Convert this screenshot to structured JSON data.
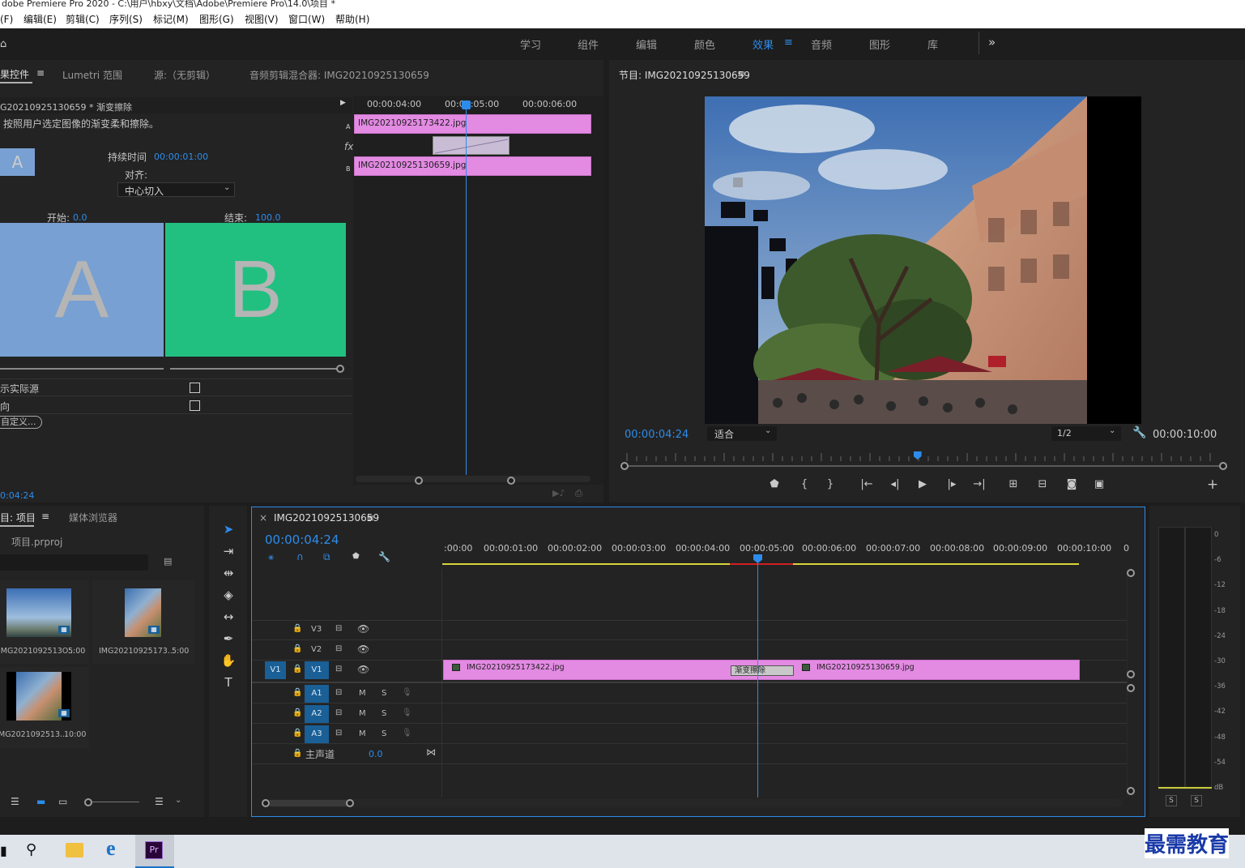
{
  "window_title": "dobe Premiere Pro 2020 - C:\\用户\\hbxy\\文档\\Adobe\\Premiere Pro\\14.0\\项目 *",
  "menu": [
    "(F)",
    "编辑(E)",
    "剪辑(C)",
    "序列(S)",
    "标记(M)",
    "图形(G)",
    "视图(V)",
    "窗口(W)",
    "帮助(H)"
  ],
  "workspaces": {
    "items": [
      "学习",
      "组件",
      "编辑",
      "颜色",
      "效果",
      "音频",
      "图形",
      "库"
    ],
    "active": "效果",
    "more": "»",
    "menu_icon": "≡"
  },
  "effect_panel": {
    "tabs": [
      "果控件",
      "Lumetri 范围",
      "源:（无剪辑）",
      "音频剪辑混合器: IMG20210925130659"
    ],
    "menu_icon": "≡",
    "clip_line": "G20210925130659 * 渐变擦除",
    "description": "按照用户选定图像的渐变柔和擦除。",
    "thumb_letter": "A",
    "duration_label": "持续时间",
    "duration_value": "00:00:01:00",
    "align_label": "对齐:",
    "align_value": "中心切入",
    "start_label": "开始:",
    "start_value": "0.0",
    "end_label": "结束:",
    "end_value": "100.0",
    "preview_a": "A",
    "preview_b": "B",
    "show_actual": "示实际源",
    "reverse": "向",
    "custom": "自定义...",
    "timecode": "0:04:24",
    "mini_timeline": {
      "ticks": [
        "00:00:04:00",
        "00:00:05:00",
        "00:00:06:00"
      ],
      "clip_a": "IMG20210925173422.jpg",
      "clip_b": "IMG20210925130659.jpg",
      "label_a": "A",
      "label_b": "B",
      "fx": "fx"
    }
  },
  "program": {
    "title": "节目: IMG20210925130659",
    "menu_icon": "≡",
    "timecode": "00:00:04:24",
    "fit": "适合",
    "resolution": "1/2",
    "duration": "00:00:10:00",
    "playhead_fraction": 0.49
  },
  "project": {
    "tabs": [
      "目: 项目",
      "媒体浏览器"
    ],
    "menu_icon": "≡",
    "file": "项目.prproj",
    "items": [
      {
        "name": "IMG2021092513O...",
        "duration": "5:00"
      },
      {
        "name": "IMG20210925173...",
        "duration": "5:00"
      },
      {
        "name": "MG2021092513...",
        "duration": "10:00"
      }
    ]
  },
  "timeline": {
    "close": "×",
    "title": "IMG20210925130659",
    "menu_icon": "≡",
    "timecode": "00:00:04:24",
    "ruler": [
      ":00:00",
      "00:00:01:00",
      "00:00:02:00",
      "00:00:03:00",
      "00:00:04:00",
      "00:00:05:00",
      "00:00:06:00",
      "00:00:07:00",
      "00:00:08:00",
      "00:00:09:00",
      "00:00:10:00",
      "0"
    ],
    "video_tracks": [
      "V3",
      "V2",
      "V1"
    ],
    "source_patch": "V1",
    "audio_tracks": [
      "A1",
      "A2",
      "A3"
    ],
    "mute": "M",
    "solo": "S",
    "master_label": "主声道",
    "master_value": "0.0",
    "clip_a": "IMG20210925173422.jpg",
    "clip_b": "IMG20210925130659.jpg",
    "transition": "渐变擦除"
  },
  "meter": {
    "scale": [
      "0",
      "-6",
      "-12",
      "-18",
      "-24",
      "-30",
      "-36",
      "-42",
      "-48",
      "-54",
      "dB"
    ],
    "solo": [
      "S",
      "S"
    ]
  },
  "watermark": "最需教育",
  "colors": {
    "accent": "#2d8ceb",
    "clip": "#e38ae3",
    "preview_a": "#78a0d2",
    "preview_b": "#22c080"
  }
}
